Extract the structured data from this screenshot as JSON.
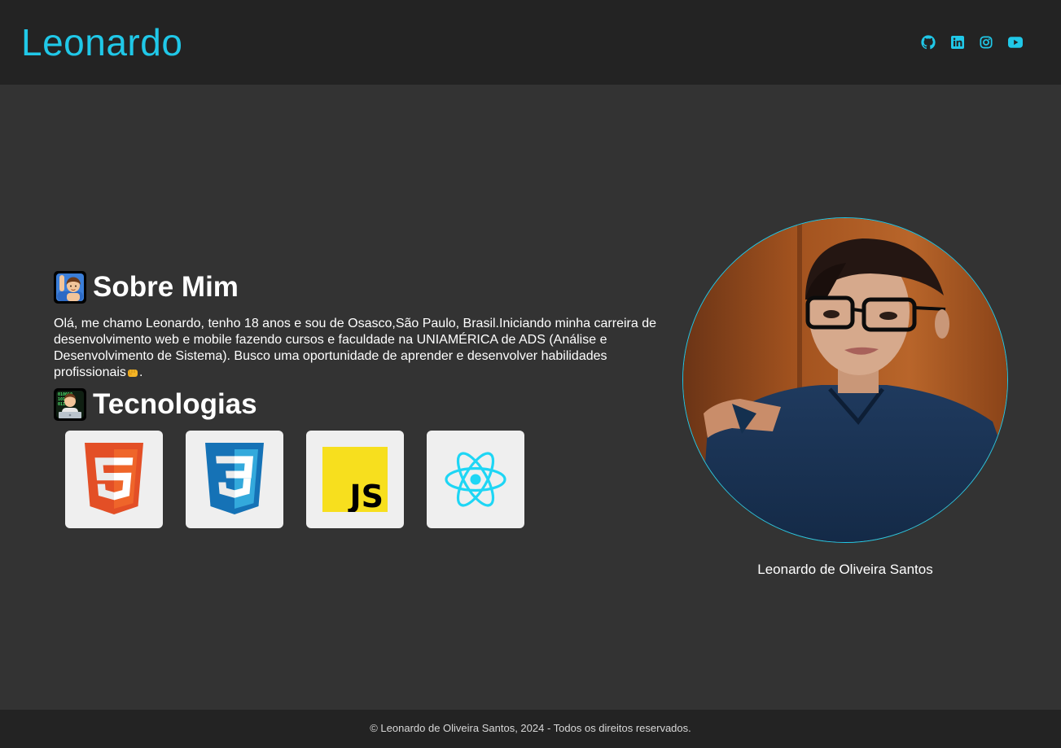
{
  "header": {
    "logo": "Leonardo",
    "socials": [
      {
        "icon": "github-icon",
        "label": "GitHub"
      },
      {
        "icon": "linkedin-icon",
        "label": "LinkedIn"
      },
      {
        "icon": "instagram-icon",
        "label": "Instagram"
      },
      {
        "icon": "youtube-icon",
        "label": "YouTube"
      }
    ]
  },
  "about": {
    "title": "Sobre Mim",
    "text_before": "Olá, me chamo Leonardo, tenho 18 anos e sou de Osasco,São Paulo, Brasil.Iniciando minha carreira de desenvolvimento web e mobile fazendo cursos e faculdade na UNIAMÉRICA de ADS (Análise e Desenvolvimento de Sistema). Busco uma oportunidade de aprender e desenvolver habilidades profissionais",
    "text_after": "."
  },
  "tech": {
    "title": "Tecnologias",
    "items": [
      {
        "name": "html5-icon"
      },
      {
        "name": "css3-icon"
      },
      {
        "name": "javascript-icon"
      },
      {
        "name": "react-icon"
      }
    ]
  },
  "profile": {
    "caption": "Leonardo de Oliveira Santos"
  },
  "footer": {
    "text": "© Leonardo de Oliveira Santos, 2024 - Todos os direitos reservados."
  },
  "colors": {
    "accent": "#20c8e8",
    "background": "#333333",
    "header": "#232323"
  }
}
